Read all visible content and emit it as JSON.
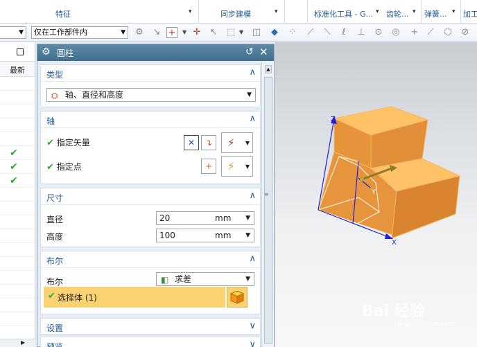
{
  "ribbon": {
    "groups": [
      "特征",
      "同步建模",
      "标准化工具 - G...",
      "齿轮...",
      "弹簧...",
      "加工"
    ]
  },
  "toolbar": {
    "filter_value": "",
    "scope_value": "仅在工作部件内"
  },
  "navigator": {
    "column_header": "最新",
    "rows_checked": [
      false,
      false,
      false,
      false,
      false,
      true,
      true,
      true,
      false,
      false,
      false,
      false,
      false,
      false,
      false,
      false,
      false,
      false
    ]
  },
  "dialog": {
    "title": "圆柱",
    "sections": {
      "type": {
        "label": "类型",
        "value": "轴、直径和高度"
      },
      "axis": {
        "label": "轴",
        "specify_vector": "指定矢量",
        "specify_point": "指定点"
      },
      "dimensions": {
        "label": "尺寸",
        "diameter_label": "直径",
        "diameter_value": "20",
        "diameter_unit": "mm",
        "height_label": "高度",
        "height_value": "100",
        "height_unit": "mm"
      },
      "boolean": {
        "label": "布尔",
        "field_label": "布尔",
        "value": "求差",
        "select_body": "选择体 (1)"
      },
      "settings": {
        "label": "设置"
      },
      "preview": {
        "label": "预览"
      }
    }
  },
  "viewport": {
    "axis_labels": {
      "x": "X",
      "y": "Y",
      "z": "Z"
    },
    "watermark": "Bai 经验",
    "watermark_sub": "jingyan.baidu.com"
  },
  "colors": {
    "dialog_title_bar": "#4a7896",
    "section_label": "#1f5a96",
    "highlight_row": "#fbd272",
    "part_face": "#f0a846",
    "checkmark": "#39a33a"
  }
}
